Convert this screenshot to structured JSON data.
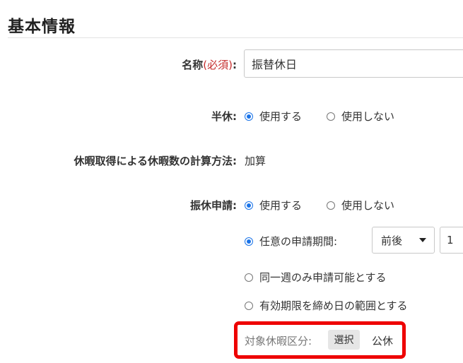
{
  "section": {
    "title": "基本情報"
  },
  "name_field": {
    "label": "名称",
    "required": "(必須)",
    "colon": ":",
    "value": "振替休日"
  },
  "half_day": {
    "label": "半休:",
    "options": [
      "使用する",
      "使用しない"
    ],
    "selected": "使用する"
  },
  "calc_method": {
    "label": "休暇取得による休暇数の計算方法:",
    "value": "加算"
  },
  "substitute_request": {
    "label": "振休申請:",
    "options": [
      "使用する",
      "使用しない"
    ],
    "selected": "使用する",
    "period_options": {
      "any": "任意の申請期間:",
      "same_week": "同一週のみ申請可能とする",
      "deadline": "有効期限を締め日の範囲とする"
    },
    "period_selected": "任意の申請期間:",
    "range_select": "前後",
    "range_number": "1"
  },
  "target_leave": {
    "label": "対象休暇区分:",
    "button": "選択",
    "value": "公休"
  },
  "colors": {
    "accent": "#1a73e8",
    "required": "#c62f2f",
    "highlight": "#ee0000"
  }
}
